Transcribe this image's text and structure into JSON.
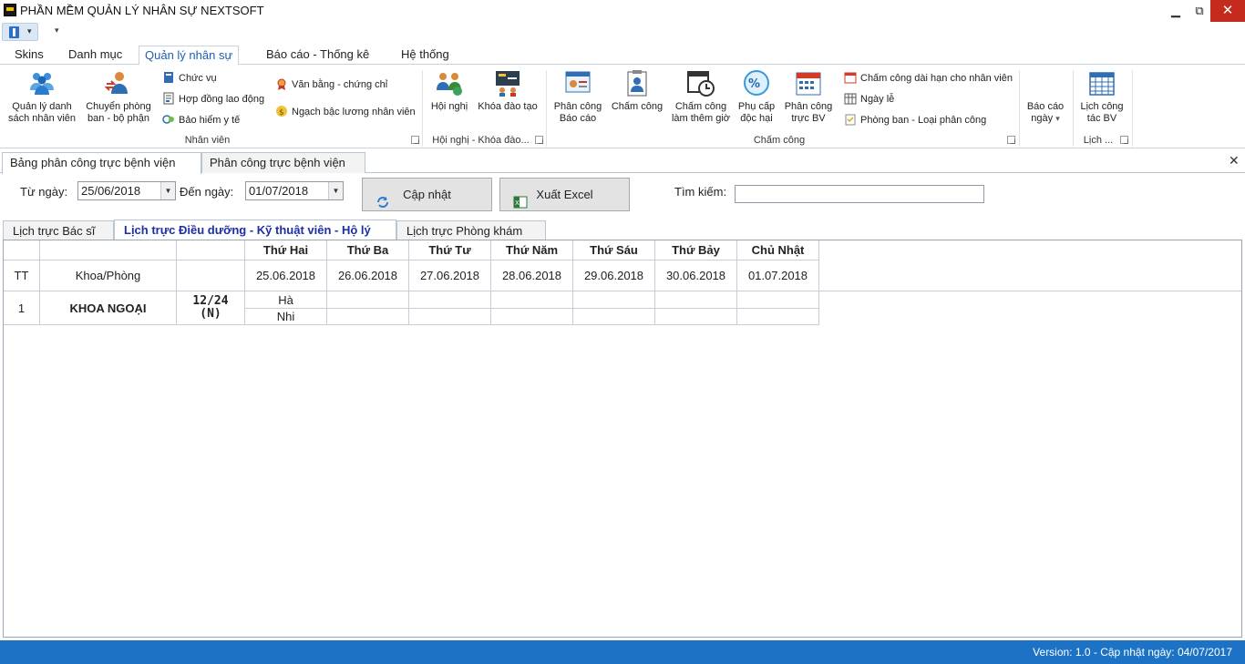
{
  "window": {
    "title": "PHẦN MỀM QUẢN LÝ NHÂN SỰ NEXTSOFT",
    "minimize": "▁",
    "maximize": "⧉",
    "close": "✕"
  },
  "qat": {
    "customize": "▾"
  },
  "ribbon_tabs": [
    {
      "label": "Skins",
      "active": false
    },
    {
      "label": "Danh mục",
      "active": false
    },
    {
      "label": "Quản lý nhân sự",
      "active": true
    },
    {
      "label": "Báo cáo - Thống kê",
      "active": false
    },
    {
      "label": "Hệ thống",
      "active": false
    }
  ],
  "ribbon": {
    "nhan_vien": {
      "label": "Nhân viên",
      "quan_ly_danh_sach": "Quản lý danh sách nhân viên",
      "chuyen_phong_ban": "Chuyển phòng ban - bộ phận",
      "chuc_vu": "Chức vụ",
      "hop_dong": "Hợp đồng lao động",
      "bao_hiem": "Bảo hiểm y tế",
      "van_bang": "Văn bằng - chứng chỉ",
      "ngach_bac": "Ngạch bậc lương nhân viên"
    },
    "hoi_nghi": {
      "label": "Hội nghị - Khóa đào...",
      "hoi_nghi": "Hội nghị",
      "khoa_dao_tao": "Khóa đào tạo"
    },
    "cham_cong": {
      "label": "Chấm công",
      "phan_cong_bao_cao": "Phân công Báo cáo",
      "cham_cong": "Chấm công",
      "cham_cong_them_gio": "Chấm công làm thêm giờ",
      "phu_cap": "Phụ cấp độc hại",
      "phan_cong_truc": "Phân công trực BV",
      "cham_cong_dai_han": "Chấm công dài hạn cho nhân viên",
      "ngay_le": "Ngày lễ",
      "phong_ban_loai": "Phòng ban - Loại phân công"
    },
    "bao_cao_ngay": {
      "label": "Báo cáo ngày",
      "arrow": "▾"
    },
    "lich": {
      "label": "Lịch ...",
      "lich_cong_tac": "Lịch công tác BV"
    }
  },
  "doc_tabs": [
    {
      "label": "Bảng phân công trực bệnh viện",
      "active": true
    },
    {
      "label": "Phân công trực bệnh viện",
      "active": false
    }
  ],
  "doc_close": "✕",
  "filter": {
    "from_label": "Từ ngày:",
    "from_value": "25/06/2018",
    "to_label": "Đến ngày:",
    "to_value": "01/07/2018",
    "update_button": "Cập nhật",
    "excel_button": "Xuất Excel",
    "search_label": "Tìm kiếm:",
    "search_value": ""
  },
  "sub_tabs": [
    {
      "label": "Lịch trực Bác sĩ",
      "active": false
    },
    {
      "label": "Lịch trực Điều dưỡng - Kỹ thuật viên - Hộ lý",
      "active": true
    },
    {
      "label": "Lịch trực Phòng khám",
      "active": false
    }
  ],
  "grid": {
    "col_tt": "TT",
    "col_khoa": "Khoa/Phòng",
    "days": [
      {
        "name": "Thứ Hai",
        "date": "25.06.2018"
      },
      {
        "name": "Thứ Ba",
        "date": "26.06.2018"
      },
      {
        "name": "Thứ Tư",
        "date": "27.06.2018"
      },
      {
        "name": "Thứ Năm",
        "date": "28.06.2018"
      },
      {
        "name": "Thứ Sáu",
        "date": "29.06.2018"
      },
      {
        "name": "Thứ Bảy",
        "date": "30.06.2018"
      },
      {
        "name": "Chủ Nhật",
        "date": "01.07.2018"
      }
    ],
    "rows": [
      {
        "tt": "1",
        "khoa": "KHOA NGOẠI",
        "shift": "12/24 (N)",
        "monday": [
          "Hà",
          "Nhi"
        ]
      }
    ]
  },
  "status": {
    "text": "Version: 1.0 - Cập nhật ngày: 04/07/2017"
  }
}
